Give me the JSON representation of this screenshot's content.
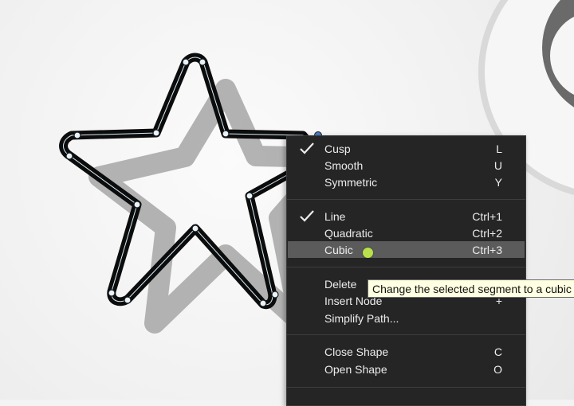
{
  "menu": {
    "items": [
      {
        "label": "Cusp",
        "shortcut": "L",
        "checked": true
      },
      {
        "label": "Smooth",
        "shortcut": "U",
        "checked": false
      },
      {
        "label": "Symmetric",
        "shortcut": "Y",
        "checked": false
      },
      {
        "label": "Line",
        "shortcut": "Ctrl+1",
        "checked": true
      },
      {
        "label": "Quadratic",
        "shortcut": "Ctrl+2",
        "checked": false
      },
      {
        "label": "Cubic",
        "shortcut": "Ctrl+3",
        "checked": false,
        "highlighted": true
      },
      {
        "label": "Delete",
        "shortcut": "",
        "checked": false
      },
      {
        "label": "Insert Node",
        "shortcut": "+",
        "checked": false
      },
      {
        "label": "Simplify Path...",
        "shortcut": "",
        "checked": false
      },
      {
        "label": "Close Shape",
        "shortcut": "C",
        "checked": false
      },
      {
        "label": "Open Shape",
        "shortcut": "O",
        "checked": false
      }
    ]
  },
  "tooltip": {
    "text": "Change the selected segment to a cubic s"
  },
  "colors": {
    "menu_bg": "#252525",
    "highlight": "#5b5b5b",
    "tooltip_bg": "#ffffe1",
    "cursor": "#b8e04a",
    "node_fill": "#e8f4fb",
    "path_stroke": "#111111"
  }
}
